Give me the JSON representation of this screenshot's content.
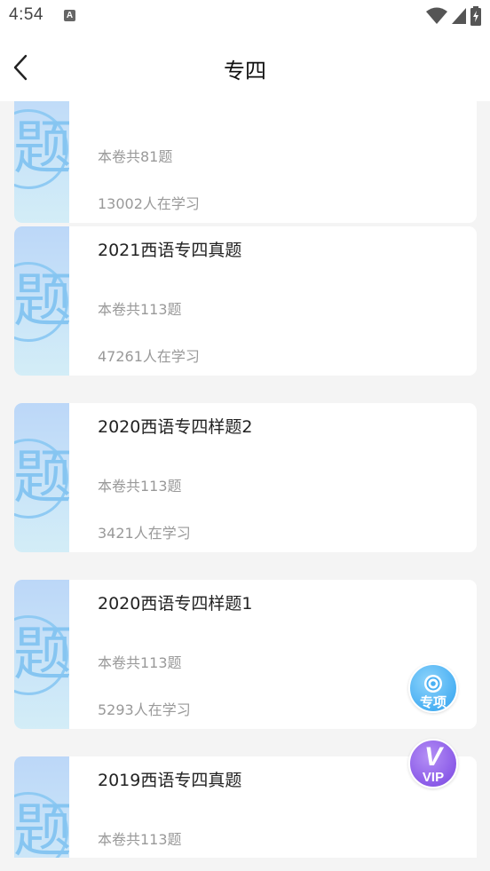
{
  "status_bar": {
    "time": "4:54",
    "notification_icon": "A",
    "icons": [
      "wifi-icon",
      "signal-icon",
      "battery-charging-icon"
    ]
  },
  "header": {
    "back_icon": "chevron-left-icon",
    "title": "专四"
  },
  "papers": [
    {
      "title": "",
      "question_count": "本卷共81题",
      "learners": "13002人在学习",
      "thumb_char": "题"
    },
    {
      "title": "2021西语专四真题",
      "question_count": "本卷共113题",
      "learners": "47261人在学习",
      "thumb_char": "题"
    },
    {
      "title": "2020西语专四样题2",
      "question_count": "本卷共113题",
      "learners": "3421人在学习",
      "thumb_char": "题"
    },
    {
      "title": "2020西语专四样题1",
      "question_count": "本卷共113题",
      "learners": "5293人在学习",
      "thumb_char": "题"
    },
    {
      "title": "2019西语专四真题",
      "question_count": "本卷共113题",
      "learners": "",
      "thumb_char": "题"
    }
  ],
  "floating_buttons": {
    "topic_label": "专项",
    "vip_label": "VIP",
    "vip_letter": "V"
  },
  "colors": {
    "thumb_gradient_top": "#bcd7f8",
    "thumb_char": "#86c5f1",
    "topic_button": "#4ab0f3",
    "vip_button": "#8b5be8"
  }
}
